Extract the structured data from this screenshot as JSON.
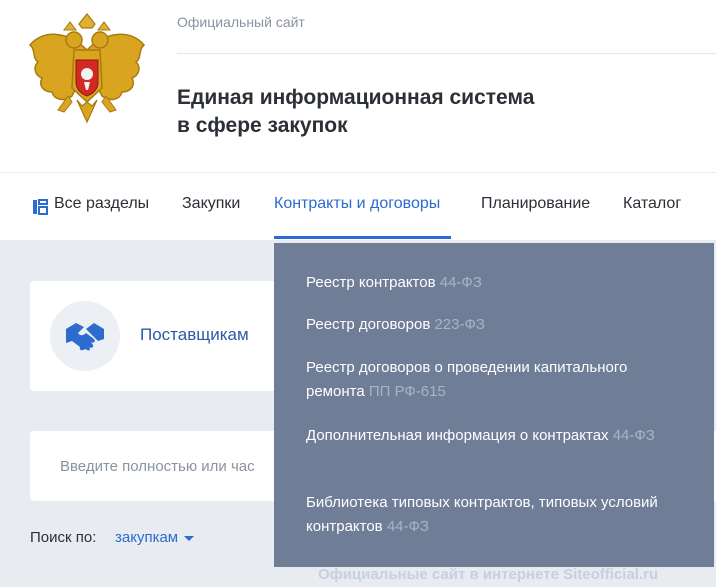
{
  "header": {
    "official": "Официальный сайт",
    "title_line1": "Единая информационная система",
    "title_line2": "в сфере закупок"
  },
  "nav": {
    "items": [
      {
        "label": "Все разделы"
      },
      {
        "label": "Закупки"
      },
      {
        "label": "Контракты и договоры"
      },
      {
        "label": "Планирование"
      },
      {
        "label": "Каталог"
      }
    ],
    "active_index": 2
  },
  "suppliers": {
    "label": "Поставщикам",
    "icon": "handshake-icon"
  },
  "search": {
    "placeholder": "Введите полностью или час"
  },
  "search_by": {
    "label": "Поиск по:",
    "value": "закупкам"
  },
  "dropdown": {
    "items": [
      {
        "text": "Реестр контрактов ",
        "law": "44-ФЗ"
      },
      {
        "text": "Реестр договоров ",
        "law": "223-ФЗ"
      },
      {
        "text": "Реестр договоров о проведении капитального ремонта ",
        "law": "ПП РФ-615"
      },
      {
        "text": "Дополнительная информация о контрактах ",
        "law": "44-ФЗ"
      },
      {
        "text": "Библиотека типовых контрактов, типовых условий контрактов ",
        "law": "44-ФЗ"
      }
    ]
  },
  "watermark": "Официальные сайт в интернете Siteofficial.ru",
  "colors": {
    "accent": "#2c6bcf",
    "dropdown_bg": "#6f7d97",
    "page_bg": "#e8ebf0"
  }
}
